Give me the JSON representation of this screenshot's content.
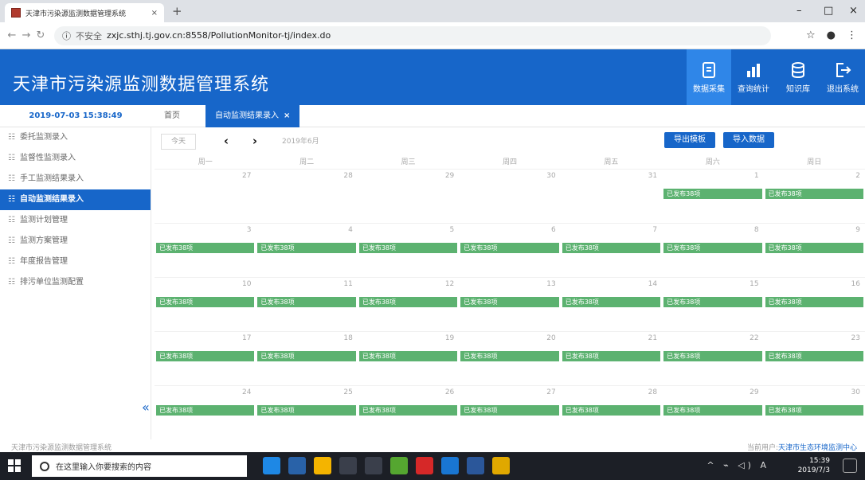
{
  "browser": {
    "tab_title": "天津市污染源监测数据管理系统",
    "tab_close": "×",
    "new_tab": "+",
    "insecure_label": "不安全",
    "url": "zxjc.sthj.tj.gov.cn:8558/PollutionMonitor-tj/index.do",
    "star_icon": "☆",
    "account_icon": "●",
    "menu_icon": "⋮",
    "win_min": "–",
    "win_max": "□",
    "win_close": "×"
  },
  "app": {
    "title": "天津市污染源监测数据管理系统",
    "nav": [
      {
        "label": "数据采集",
        "icon": "data-entry-icon",
        "active": true
      },
      {
        "label": "查询统计",
        "icon": "bar-chart-icon",
        "active": false
      },
      {
        "label": "知识库",
        "icon": "database-icon",
        "active": false
      },
      {
        "label": "退出系统",
        "icon": "logout-icon",
        "active": false
      }
    ]
  },
  "clock": "2019-07-03 15:38:49",
  "page_tabs": {
    "home": "首页",
    "active": "自动监测结果录入",
    "close": "×"
  },
  "sidebar": {
    "items": [
      {
        "label": "委托监测录入",
        "active": false
      },
      {
        "label": "监督性监测录入",
        "active": false
      },
      {
        "label": "手工监测结果录入",
        "active": false
      },
      {
        "label": "自动监测结果录入",
        "active": true
      },
      {
        "label": "监测计划管理",
        "active": false
      },
      {
        "label": "监测方案管理",
        "active": false
      },
      {
        "label": "年度报告管理",
        "active": false
      },
      {
        "label": "排污单位监测配置",
        "active": false
      }
    ],
    "collapse_icon": "«"
  },
  "calendar": {
    "today_btn": "今天",
    "prev": "‹",
    "next": "›",
    "month_label": "2019年6月",
    "export_btn": "导出模板",
    "import_btn": "导入数据",
    "weekdays": [
      "周一",
      "周二",
      "周三",
      "周四",
      "周五",
      "周六",
      "周日"
    ],
    "weeks": [
      {
        "days": [
          "27",
          "28",
          "29",
          "30",
          "31",
          "1",
          "2"
        ],
        "events": [
          false,
          false,
          false,
          false,
          false,
          true,
          true
        ]
      },
      {
        "days": [
          "3",
          "4",
          "5",
          "6",
          "7",
          "8",
          "9"
        ],
        "events": [
          true,
          true,
          true,
          true,
          true,
          true,
          true
        ]
      },
      {
        "days": [
          "10",
          "11",
          "12",
          "13",
          "14",
          "15",
          "16"
        ],
        "events": [
          true,
          true,
          true,
          true,
          true,
          true,
          true
        ]
      },
      {
        "days": [
          "17",
          "18",
          "19",
          "20",
          "21",
          "22",
          "23"
        ],
        "events": [
          true,
          true,
          true,
          true,
          true,
          true,
          true
        ]
      },
      {
        "days": [
          "24",
          "25",
          "26",
          "27",
          "28",
          "29",
          "30"
        ],
        "events": [
          true,
          true,
          true,
          true,
          true,
          true,
          true
        ]
      }
    ],
    "event_label": "已发布38项"
  },
  "footer": {
    "left": "天津市污染源监测数据管理系统",
    "right_prefix": "当前用户:",
    "user": "天津市生态环境监测中心"
  },
  "taskbar": {
    "search_placeholder": "在这里输入你要搜索的内容",
    "time": "15:39",
    "date": "2019/7/3",
    "tray_text": "^ ⌁ ◁) A"
  }
}
